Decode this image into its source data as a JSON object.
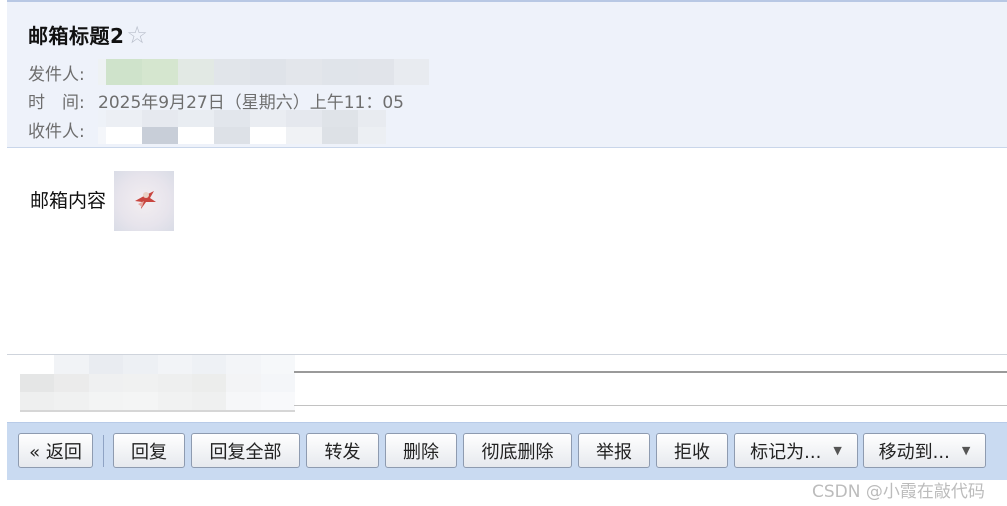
{
  "email": {
    "subject": "邮箱标题2",
    "star_icon": "☆",
    "sender_label": "发件人:",
    "time_label": "时　间:",
    "time_value": "2025年9月27日（星期六）上午11：05",
    "recipient_label": "收件人:",
    "body_text": "邮箱内容"
  },
  "toolbar": {
    "back": "« 返回",
    "reply": "回复",
    "reply_all": "回复全部",
    "forward": "转发",
    "delete": "删除",
    "delete_permanent": "彻底删除",
    "report": "举报",
    "reject": "拒收",
    "mark_as": "标记为...",
    "move_to": "移动到...",
    "dropdown_icon": "▼"
  },
  "watermark": "CSDN @小霞在敲代码",
  "colors": {
    "header_bg": "#eef2fa",
    "toolbar_bg": "#c9daf1",
    "label_gray": "#6e6e6e"
  }
}
